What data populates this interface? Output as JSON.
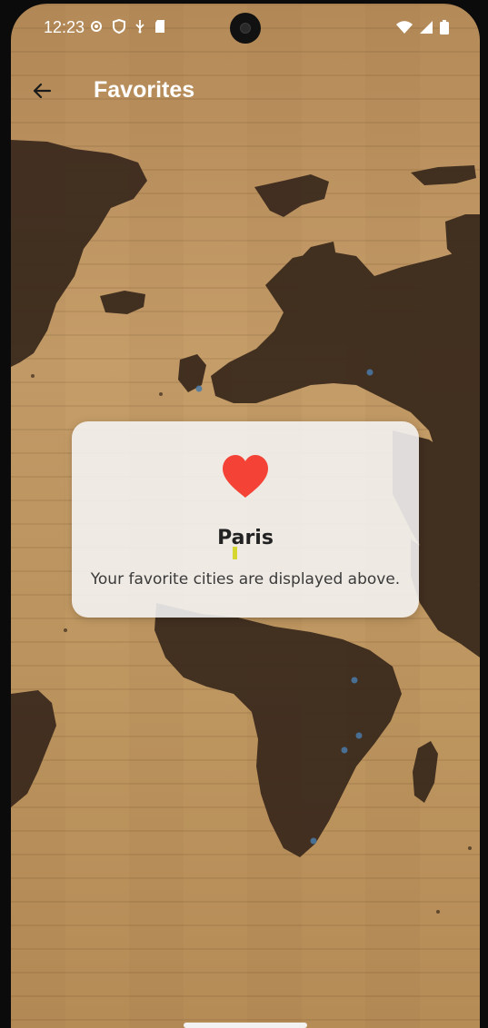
{
  "status_bar": {
    "time": "12:23",
    "left_icons": [
      "gear-icon",
      "shield-icon",
      "usb-icon",
      "sd-card-icon"
    ],
    "right_icons": [
      "wifi-icon",
      "signal-icon",
      "battery-icon"
    ]
  },
  "app_bar": {
    "back_icon": "arrow-left-icon",
    "title": "Favorites"
  },
  "card": {
    "icon": "heart-icon",
    "icon_color": "#F44336",
    "city": "Paris",
    "message": "Your favorite cities are displayed above."
  },
  "background": {
    "description_icon": "world-map-wood",
    "wood_color": "#C49B67",
    "map_color": "#3A2A1E"
  }
}
